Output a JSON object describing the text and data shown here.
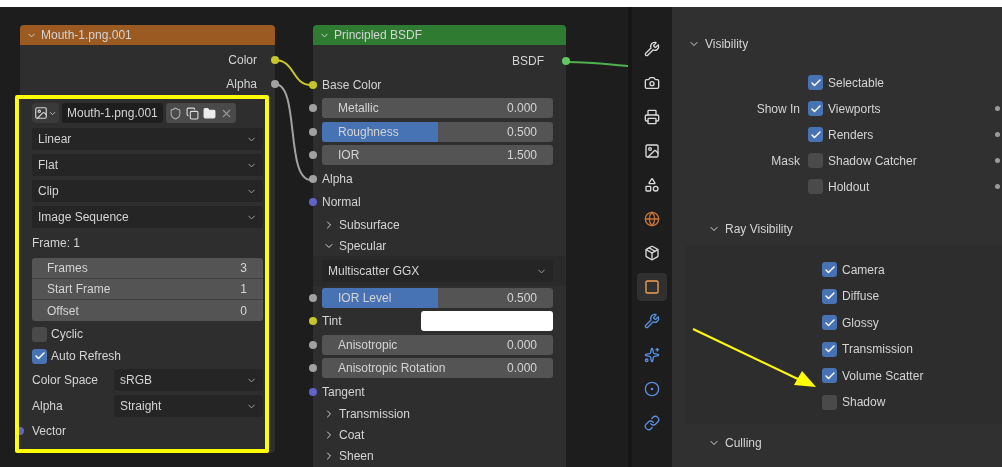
{
  "image_node": {
    "title": "Mouth-1.png.001",
    "outputs": [
      {
        "label": "Color",
        "color": "#c7c729"
      },
      {
        "label": "Alpha",
        "color": "#a1a1a1"
      }
    ],
    "image_field": "Mouth-1.png.001",
    "dropdowns": [
      "Linear",
      "Flat",
      "Clip",
      "Image Sequence"
    ],
    "frame_label": "Frame: 1",
    "fields": [
      {
        "label": "Frames",
        "value": "3"
      },
      {
        "label": "Start Frame",
        "value": "1"
      },
      {
        "label": "Offset",
        "value": "0"
      }
    ],
    "checkboxes": [
      {
        "label": "Cyclic",
        "checked": false
      },
      {
        "label": "Auto Refresh",
        "checked": true
      }
    ],
    "props": [
      {
        "label": "Color Space",
        "value": "sRGB"
      },
      {
        "label": "Alpha",
        "value": "Straight"
      }
    ],
    "inputs": [
      {
        "label": "Vector",
        "color": "#6363c7"
      }
    ]
  },
  "bsdf_node": {
    "title": "Principled BSDF",
    "output": {
      "label": "BSDF",
      "color": "#63c763"
    },
    "rows": [
      {
        "kind": "socket",
        "label": "Base Color",
        "color": "#c7c729"
      },
      {
        "kind": "field",
        "label": "Metallic",
        "value": "0.000",
        "color": "#a1a1a1"
      },
      {
        "kind": "slider",
        "label": "Roughness",
        "value": "0.500",
        "level": 0.5,
        "color": "#a1a1a1"
      },
      {
        "kind": "field",
        "label": "IOR",
        "value": "1.500",
        "color": "#a1a1a1"
      },
      {
        "kind": "socket",
        "label": "Alpha",
        "color": "#a1a1a1"
      },
      {
        "kind": "socket",
        "label": "Normal",
        "color": "#6363c7"
      },
      {
        "kind": "panel",
        "label": "Subsurface",
        "expanded": false
      },
      {
        "kind": "panel",
        "label": "Specular",
        "expanded": true
      },
      {
        "kind": "dropdown",
        "value": "Multiscatter GGX"
      },
      {
        "kind": "slider",
        "label": "IOR Level",
        "value": "0.500",
        "level": 0.5,
        "color": "#a1a1a1"
      },
      {
        "kind": "color",
        "label": "Tint",
        "color": "#c7c729"
      },
      {
        "kind": "field",
        "label": "Anisotropic",
        "value": "0.000",
        "color": "#a1a1a1"
      },
      {
        "kind": "field",
        "label": "Anisotropic Rotation",
        "value": "0.000",
        "color": "#a1a1a1"
      },
      {
        "kind": "socket",
        "label": "Tangent",
        "color": "#6363c7"
      },
      {
        "kind": "panel",
        "label": "Transmission",
        "expanded": false
      },
      {
        "kind": "panel",
        "label": "Coat",
        "expanded": false
      },
      {
        "kind": "panel",
        "label": "Sheen",
        "expanded": false
      }
    ]
  },
  "sidebar_tabs": [
    {
      "kind": "tool",
      "selected": false
    },
    {
      "kind": "render",
      "selected": false
    },
    {
      "kind": "output",
      "selected": false
    },
    {
      "kind": "view_layer",
      "selected": false
    },
    {
      "kind": "scene",
      "selected": false
    },
    {
      "kind": "world",
      "selected": false
    },
    {
      "kind": "collection",
      "selected": false
    },
    {
      "kind": "object",
      "selected": true
    },
    {
      "kind": "modifier",
      "selected": false
    },
    {
      "kind": "particles",
      "selected": false
    },
    {
      "kind": "physics",
      "selected": false
    },
    {
      "kind": "constraints",
      "selected": false
    }
  ],
  "properties": {
    "visibility": {
      "title": "Visibility",
      "expanded": true,
      "rows": [
        {
          "label": "Selectable",
          "checked": true,
          "animatable": false
        },
        {
          "group": "Show In",
          "label": "Viewports",
          "checked": true,
          "animatable": true
        },
        {
          "label": "Renders",
          "checked": true,
          "animatable": true
        },
        {
          "group": "Mask",
          "label": "Shadow Catcher",
          "checked": false,
          "animatable": true
        },
        {
          "label": "Holdout",
          "checked": false,
          "animatable": true
        }
      ]
    },
    "ray_visibility": {
      "title": "Ray Visibility",
      "expanded": true,
      "rows": [
        {
          "label": "Camera",
          "checked": true
        },
        {
          "label": "Diffuse",
          "checked": true
        },
        {
          "label": "Glossy",
          "checked": true
        },
        {
          "label": "Transmission",
          "checked": true
        },
        {
          "label": "Volume Scatter",
          "checked": true
        },
        {
          "label": "Shadow",
          "checked": false
        }
      ]
    },
    "culling": {
      "title": "Culling",
      "expanded": true
    }
  }
}
